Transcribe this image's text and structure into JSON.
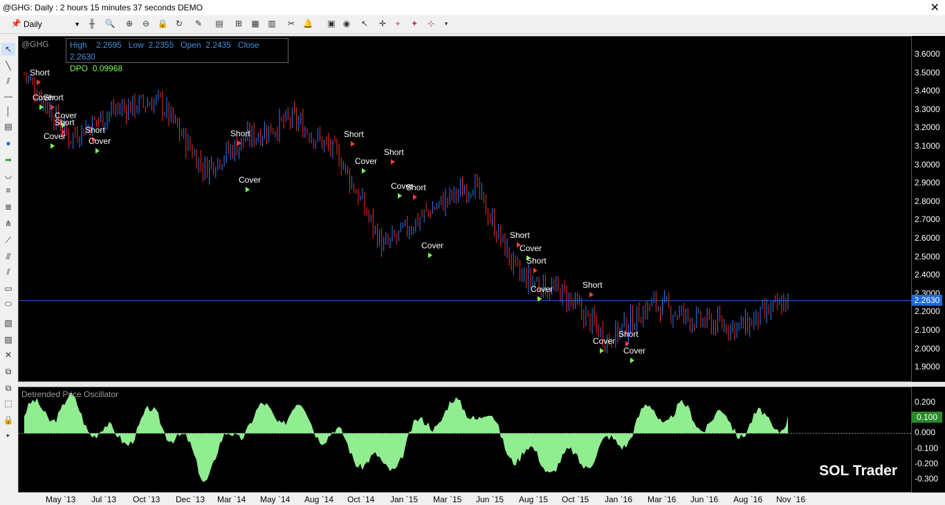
{
  "window": {
    "title": "@GHG: Daily : 2 hours 15 minutes 37 seconds DEMO",
    "close_glyph": "✕"
  },
  "toolbar": {
    "interval": "Daily"
  },
  "chart": {
    "symbol": "@GHG",
    "info": {
      "high_label": "High",
      "high": "2.2695",
      "low_label": "Low",
      "low": "2.2355",
      "open_label": "Open",
      "open": "2.2435",
      "close_label": "Close",
      "close": "2.2630",
      "dpo_label": "DPO",
      "dpo": "0.09968"
    },
    "current_price": "2.2630",
    "price_ticks": [
      "3.6000",
      "3.5000",
      "3.4000",
      "3.3000",
      "3.2000",
      "3.1000",
      "3.0000",
      "2.9000",
      "2.8000",
      "2.7000",
      "2.6000",
      "2.5000",
      "2.4000",
      "2.3000",
      "2.2000",
      "2.1000",
      "2.0000",
      "1.9000"
    ],
    "signal_labels": [
      {
        "text": "Short"
      },
      {
        "text": "Cover"
      },
      {
        "text": "Short"
      },
      {
        "text": "Cover"
      },
      {
        "text": "Short"
      },
      {
        "text": "Cover"
      },
      {
        "text": "Short"
      },
      {
        "text": "Cover"
      },
      {
        "text": "Short"
      },
      {
        "text": "Cover"
      },
      {
        "text": "Short"
      },
      {
        "text": "Cover"
      },
      {
        "text": "Short"
      },
      {
        "text": "Cover"
      },
      {
        "text": "Short"
      },
      {
        "text": "Cover"
      },
      {
        "text": "Short"
      },
      {
        "text": "Cover"
      },
      {
        "text": "Short"
      },
      {
        "text": "Cover"
      },
      {
        "text": "Short"
      },
      {
        "text": "Cover"
      },
      {
        "text": "Short"
      },
      {
        "text": "Cover"
      },
      {
        "text": "Short"
      },
      {
        "text": "Cover"
      },
      {
        "text": "Short"
      },
      {
        "text": "Cover"
      }
    ],
    "colors": {
      "up": "#2f7fff",
      "down": "#ff2a2a",
      "signal_short": "#ff3b3b",
      "signal_cover": "#7cfc5a",
      "price_line": "#1e6ad6",
      "oscillator": "#90ee90"
    }
  },
  "oscillator": {
    "name": "Detrended Price Oscillator",
    "current": "0.100",
    "ticks": [
      "0.200",
      "0.100",
      "0.000",
      "-0.100",
      "-0.200",
      "-0.300"
    ]
  },
  "watermark": "SOL Trader",
  "date_axis": [
    "May `13",
    "Jul `13",
    "Oct `13",
    "Dec `13",
    "Mar `14",
    "May `14",
    "Aug `14",
    "Oct `14",
    "Jan `15",
    "Mar `15",
    "Jun `15",
    "Aug `15",
    "Oct `15",
    "Jan `16",
    "Mar `16",
    "Jun `16",
    "Aug `16",
    "Nov `16"
  ],
  "chart_data": {
    "type": "candlestick",
    "series": [
      {
        "name": "@GHG",
        "x": [
          "May `13",
          "Jul `13",
          "Oct `13",
          "Dec `13",
          "Mar `14",
          "May `14",
          "Aug `14",
          "Oct `14",
          "Jan `15",
          "Mar `15",
          "Jun `15",
          "Aug `15",
          "Oct `15",
          "Jan `16",
          "Mar `16",
          "Jun `16",
          "Aug `16",
          "Nov `16"
        ],
        "values": [
          3.5,
          3.15,
          3.3,
          3.35,
          2.98,
          3.15,
          3.25,
          3.05,
          2.55,
          2.75,
          2.9,
          2.4,
          2.3,
          2.05,
          2.25,
          2.15,
          2.12,
          2.263
        ]
      }
    ],
    "indicator": {
      "name": "DPO",
      "values": [
        0.12,
        0.18,
        -0.05,
        0.12,
        -0.25,
        0.1,
        0.15,
        -0.05,
        -0.25,
        0.1,
        0.18,
        -0.15,
        -0.2,
        -0.1,
        0.15,
        0.1,
        0.05,
        0.1
      ]
    },
    "ylim": [
      1.85,
      3.65
    ],
    "indicator_ylim": [
      -0.34,
      0.24
    ]
  }
}
